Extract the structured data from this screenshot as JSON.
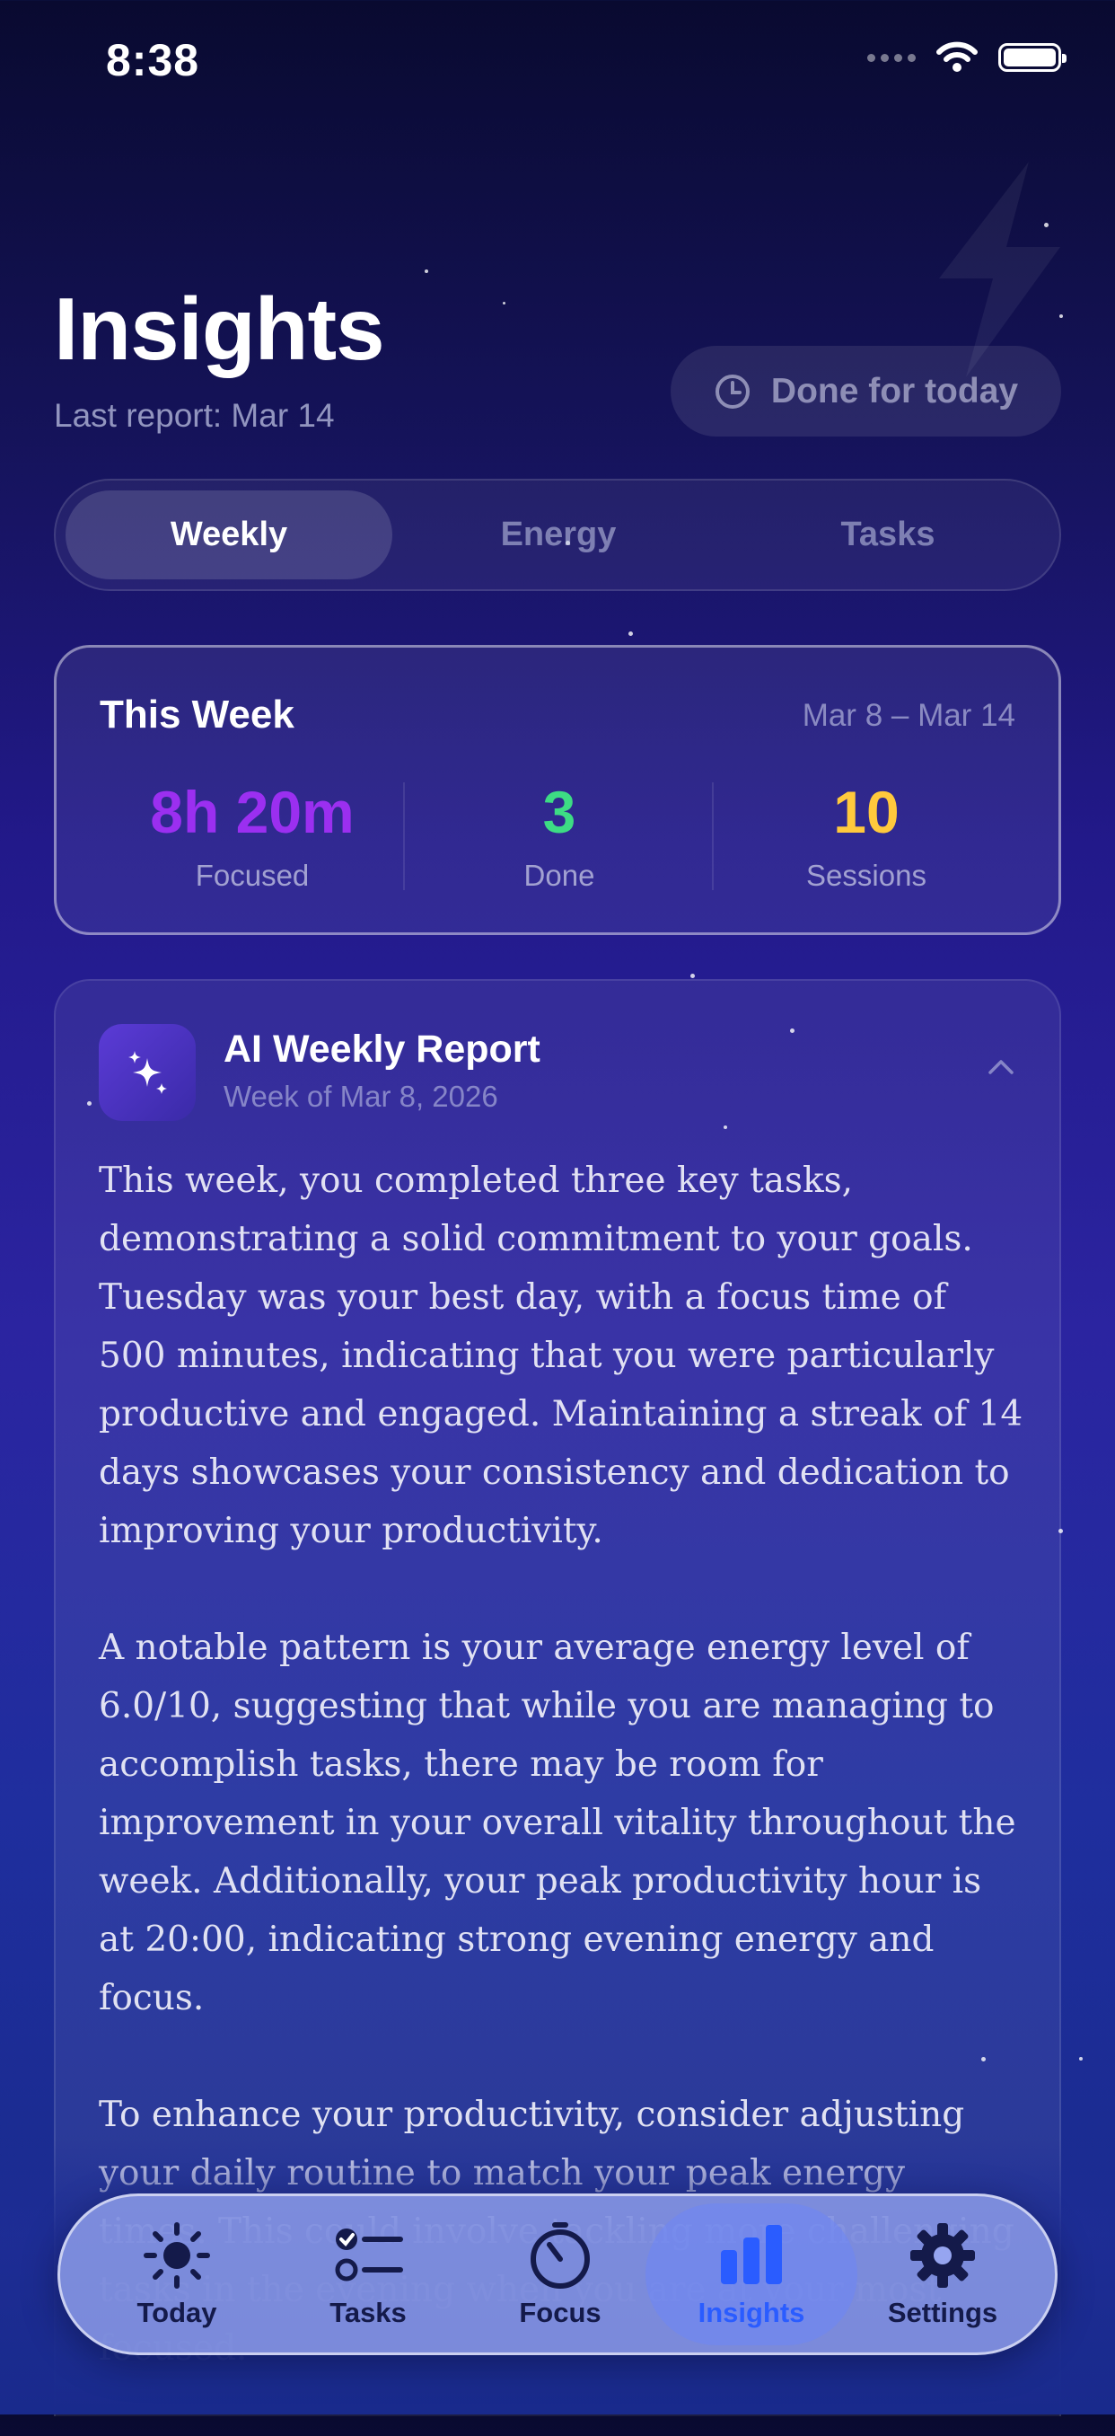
{
  "status_bar": {
    "time": "8:38"
  },
  "header": {
    "title": "Insights",
    "subtitle": "Last report: Mar 14",
    "done_button_label": "Done for today"
  },
  "segments": [
    {
      "label": "Weekly",
      "active": true
    },
    {
      "label": "Energy",
      "active": false
    },
    {
      "label": "Tasks",
      "active": false
    }
  ],
  "week_card": {
    "title": "This Week",
    "range": "Mar 8 – Mar 14",
    "stats": [
      {
        "value": "8h 20m",
        "label": "Focused",
        "color": "#9b2ff0"
      },
      {
        "value": "3",
        "label": "Done",
        "color": "#3ddc84"
      },
      {
        "value": "10",
        "label": "Sessions",
        "color": "#ffc93c"
      }
    ]
  },
  "report": {
    "title": "AI Weekly Report",
    "subtitle": "Week of Mar 8, 2026",
    "paragraphs": [
      "This week, you completed three key tasks, demonstrating a solid commitment to your goals. Tuesday was your best day, with a focus time of 500 minutes, indicating that you were particularly productive and engaged. Maintaining a streak of 14 days showcases your consistency and dedication to improving your productivity.",
      "A notable pattern is your average energy level of 6.0/10, suggesting that while you are managing to accomplish tasks, there may be room for improvement in your overall vitality throughout the week. Additionally, your peak productivity hour is at 20:00, indicating strong evening energy and focus.",
      "To enhance your productivity, consider adjusting your daily routine to match your peak energy times. This could involve tackling more challenging tasks in the evening when you are at your most focused."
    ]
  },
  "tabbar": {
    "items": [
      {
        "label": "Today",
        "icon": "sun-icon"
      },
      {
        "label": "Tasks",
        "icon": "checklist-icon"
      },
      {
        "label": "Focus",
        "icon": "timer-icon"
      },
      {
        "label": "Insights",
        "icon": "bar-chart-icon",
        "active": true
      },
      {
        "label": "Settings",
        "icon": "gear-icon"
      }
    ],
    "active_color": "#2a5cff"
  }
}
